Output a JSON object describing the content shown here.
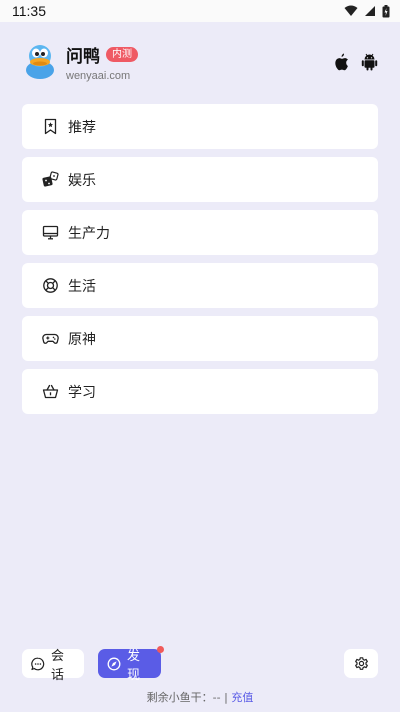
{
  "status_bar": {
    "time": "11:35"
  },
  "header": {
    "app_name": "问鸭",
    "badge": "内测",
    "domain": "wenyaai.com",
    "platform_icons": [
      "apple-icon",
      "android-icon"
    ]
  },
  "menu": [
    {
      "label": "推荐",
      "icon": "bookmark-star-icon"
    },
    {
      "label": "娱乐",
      "icon": "dice-icon"
    },
    {
      "label": "生产力",
      "icon": "monitor-icon"
    },
    {
      "label": "生活",
      "icon": "lifebuoy-icon"
    },
    {
      "label": "原神",
      "icon": "gamepad-icon"
    },
    {
      "label": "学习",
      "icon": "basket-icon"
    }
  ],
  "bottom": {
    "chat_label": "会话",
    "discover_label": "发现",
    "settings_icon": "gear-icon"
  },
  "footer": {
    "remaining_label": "剩余小鱼干：",
    "remaining_value": "-- |",
    "recharge_label": "充值"
  },
  "colors": {
    "background": "#ecebf8",
    "accent": "#5a5ce6",
    "badge": "#ef5a64"
  }
}
